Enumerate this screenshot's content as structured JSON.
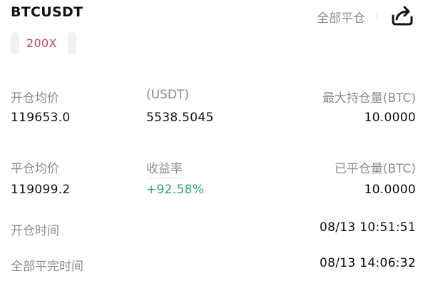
{
  "header": {
    "symbol": "BTCUSDT",
    "close_all_label": "全部平仓",
    "leverage": "200X"
  },
  "stats": {
    "open_avg_price_label": "开仓均价",
    "open_avg_price": "119653.0",
    "unit_label": "(USDT)",
    "unit_value": "5538.5045",
    "max_position_label": "最大持仓量(BTC)",
    "max_position": "10.0000",
    "close_avg_price_label": "平仓均价",
    "close_avg_price": "119099.2",
    "return_rate_label": "收益率",
    "return_rate": "+92.58%",
    "closed_position_label": "已平仓量(BTC)",
    "closed_position": "10.0000",
    "open_time_label": "开仓时间",
    "open_time": "08/13 10:51:51",
    "full_close_time_label": "全部平完时间",
    "full_close_time": "08/13 14:06:32"
  },
  "icons": {
    "share": "share-icon"
  },
  "colors": {
    "leverage_text": "#c2485e",
    "positive": "#2aa56f",
    "label": "#8a8a8a"
  }
}
